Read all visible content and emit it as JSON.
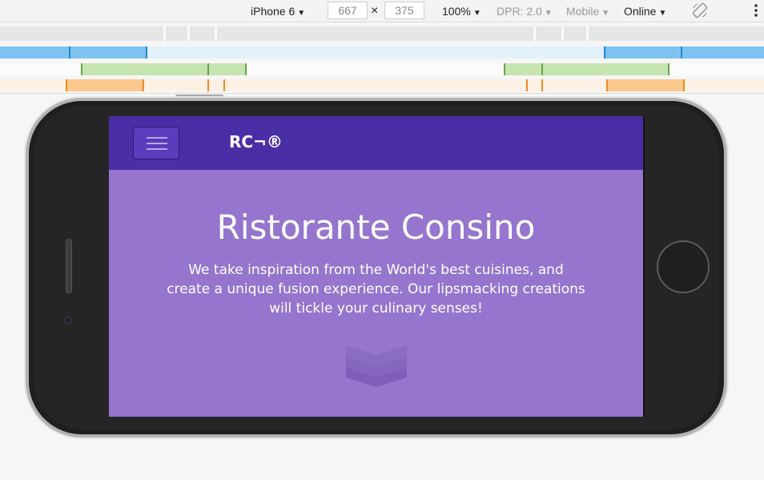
{
  "toolbar": {
    "device": "iPhone 6",
    "width": "667",
    "times": "×",
    "height": "375",
    "zoom": "100%",
    "dpr": "DPR: 2.0",
    "mode": "Mobile",
    "network": "Online",
    "arrow": "▼",
    "icons": [
      "rotate-icon",
      "more-vertical-icon"
    ]
  },
  "colors": {
    "navbar": "#4a2ea6",
    "hero": "#9575cd",
    "mq_blue": "#7ec2ef",
    "mq_green": "#c6e4b0",
    "mq_orange": "#fbc98e"
  },
  "site": {
    "brand": "RC¬®",
    "hero_title": "Ristorante Consino",
    "hero_text": "We take inspiration from the World's best cuisines, and create a unique fusion experience. Our lipsmacking creations will tickle your culinary senses!",
    "icons": [
      "hamburger-menu-icon",
      "chevron-down-icon"
    ]
  }
}
